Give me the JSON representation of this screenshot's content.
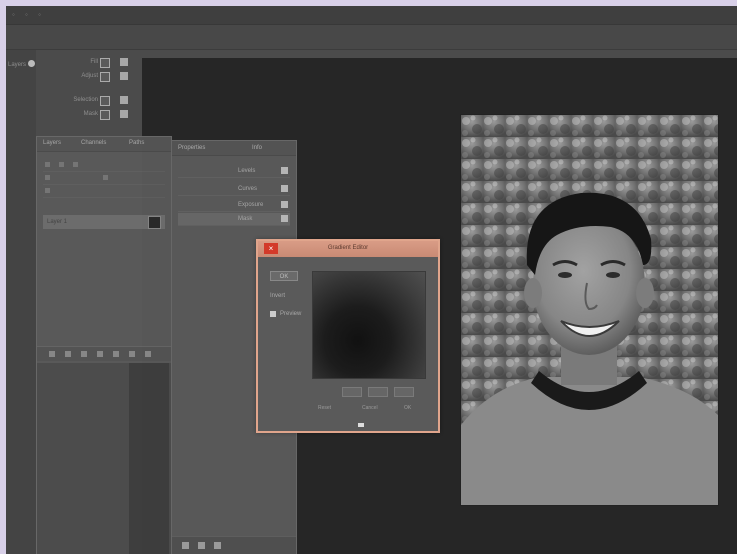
{
  "window": {
    "menu_dots": "◦ ◦ ◦"
  },
  "left_strip": {
    "label": "Layers"
  },
  "tools": [
    {
      "label": "Fill"
    },
    {
      "label": "Adjust"
    },
    {
      "label": "Selection"
    },
    {
      "label": "Mask"
    }
  ],
  "layers_panel": {
    "tabs": [
      "Layers",
      "Channels",
      "Paths"
    ],
    "selected_layer": "Layer 1"
  },
  "properties_panel": {
    "tabs": [
      "Properties",
      "Info"
    ],
    "rows": [
      "Levels",
      "Curves",
      "Exposure",
      "Mask"
    ]
  },
  "dialog": {
    "title": "Gradient Editor",
    "close": "×",
    "ok_label": "OK",
    "option_label": "Invert",
    "checkbox_label": "Preview",
    "footer_labels": [
      "Reset",
      "Cancel",
      "OK"
    ]
  },
  "colors": {
    "accent": "#e0a58c",
    "close": "#d33a2a",
    "canvas": "#262626"
  }
}
